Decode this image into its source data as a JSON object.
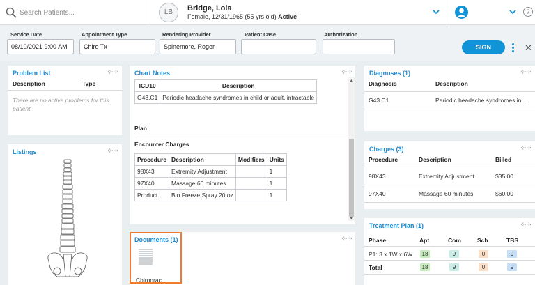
{
  "header": {
    "search_placeholder": "Search Patients...",
    "avatar_initials": "LB",
    "patient_name": "Bridge, Lola",
    "patient_info": "Female, 12/31/1965 (55 yrs old)",
    "patient_status": "Active",
    "help_glyph": "?"
  },
  "form": {
    "service_date_label": "Service Date",
    "service_date_value": "08/10/2021 9:00 AM",
    "appointment_type_label": "Appointment Type",
    "appointment_type_value": "Chiro Tx",
    "rendering_provider_label": "Rendering Provider",
    "rendering_provider_value": "Spinemore, Roger",
    "patient_case_label": "Patient Case",
    "patient_case_value": "",
    "authorization_label": "Authorization",
    "authorization_value": "",
    "sign_label": "SIGN",
    "close_glyph": "✕"
  },
  "problem_list": {
    "title": "Problem List",
    "col_description": "Description",
    "col_type": "Type",
    "empty_message": "There are no active problems for this patient."
  },
  "listings": {
    "title": "Listings"
  },
  "chart_notes": {
    "title": "Chart Notes",
    "dx_headers": [
      "ICD10",
      "Description"
    ],
    "dx_rows": [
      [
        "G43.C1",
        "Periodic headache syndromes in child or adult, intractable"
      ]
    ],
    "plan_label": "Plan",
    "encounter_label": "Encounter Charges",
    "enc_headers": [
      "Procedure",
      "Description",
      "Modifiers",
      "Units"
    ],
    "enc_rows": [
      [
        "98X43",
        "Extremity Adjustment",
        "",
        "1"
      ],
      [
        "97X40",
        "Massage 60 minutes",
        "",
        "1"
      ],
      [
        "Product",
        "Bio Freeze Spray 20 oz",
        "",
        "1"
      ]
    ]
  },
  "documents": {
    "title": "Documents (1)",
    "file_name": "Chiroprac..."
  },
  "diagnoses": {
    "title": "Diagnoses (1)",
    "col_diagnosis": "Diagnosis",
    "col_description": "Description",
    "rows": [
      [
        "G43.C1",
        "Periodic headache syndromes in ..."
      ]
    ]
  },
  "charges": {
    "title": "Charges (3)",
    "col_procedure": "Procedure",
    "col_description": "Description",
    "col_billed": "Billed",
    "rows": [
      [
        "98X43",
        "Extremity Adjustment",
        "$35.00"
      ],
      [
        "97X40",
        "Massage 60 minutes",
        "$60.00"
      ]
    ]
  },
  "treatment_plan": {
    "title": "Treatment Plan (1)",
    "headers": [
      "Phase",
      "Apt",
      "Com",
      "Sch",
      "TBS"
    ],
    "phase_row": [
      "P1: 3 x 1W x 6W",
      "18",
      "9",
      "0",
      "9"
    ],
    "total_row": [
      "Total",
      "18",
      "9",
      "0",
      "9"
    ]
  },
  "colors": {
    "accent": "#1193d7",
    "title_blue": "#1b8ad2",
    "highlight_orange": "#ee7b2e",
    "apt_badge": "#c6ebbd",
    "com_badge": "#c9ece7",
    "sch_badge": "#f9dfc8",
    "tbs_badge": "#c4def7"
  },
  "icons": [
    "search-icon",
    "chevron-down-icon",
    "user-icon",
    "help-icon",
    "kebab-menu-icon",
    "close-icon",
    "expand-icon",
    "spine-skeleton-icon",
    "document-icon"
  ]
}
